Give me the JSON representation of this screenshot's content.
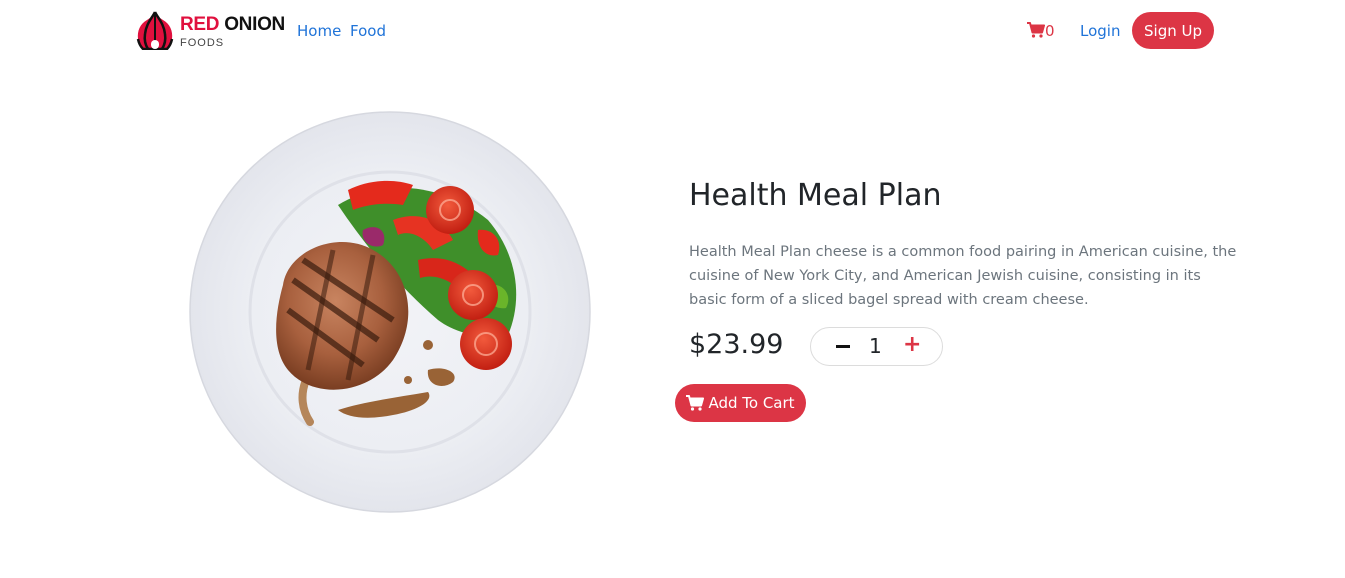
{
  "brand": {
    "title_red": "RED",
    "title_dark": "ONION",
    "subtitle": "FOODS",
    "accent_color": "#dc3545"
  },
  "nav": {
    "home": "Home",
    "food": "Food",
    "cart_count": "0",
    "login": "Login",
    "signup": "Sign Up"
  },
  "product": {
    "name": "Health Meal Plan",
    "description": "Health Meal Plan cheese is a common food pairing in American cuisine, the cuisine of New York City, and American Jewish cuisine, consisting in its basic form of a sliced bagel spread with cream cheese.",
    "price": "$23.99",
    "quantity": "1",
    "add_to_cart": "Add To Cart"
  },
  "icons": {
    "cart": "shopping-cart-icon",
    "minus": "minus-icon",
    "plus": "plus-icon"
  }
}
